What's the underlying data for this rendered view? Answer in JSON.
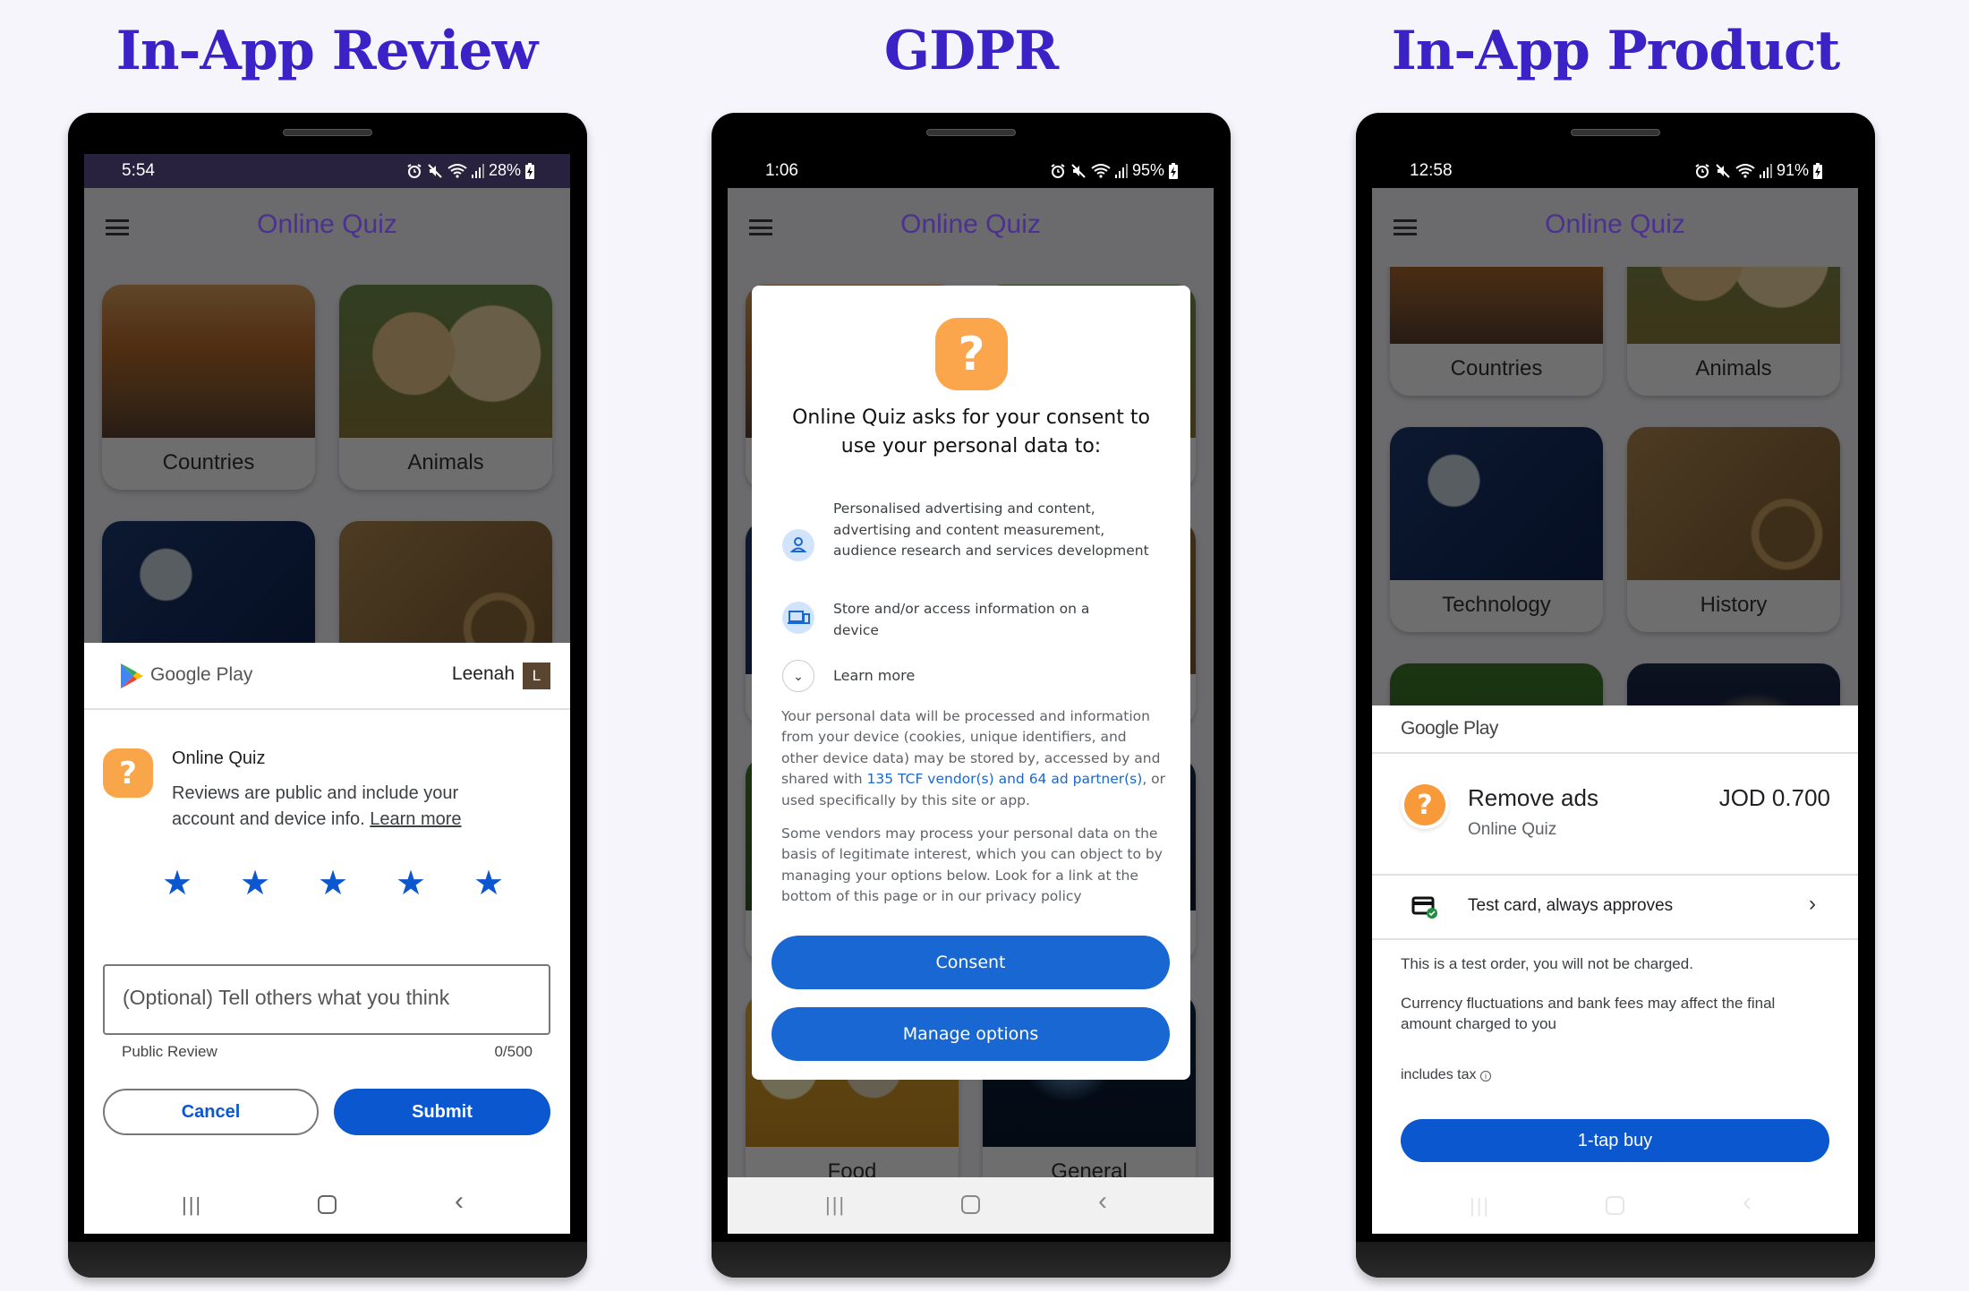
{
  "page_titles": [
    "In-App Review",
    "GDPR",
    "In-App Product"
  ],
  "app": {
    "title": "Online Quiz",
    "categories": [
      "Countries",
      "Animals",
      "Technology",
      "History",
      "",
      "",
      "Food",
      "General"
    ]
  },
  "review": {
    "status": {
      "time": "5:54",
      "battery": "28%"
    },
    "store_label": "Google Play",
    "user_name": "Leenah",
    "avatar_letter": "L",
    "app_name": "Online Quiz",
    "disclaimer": "Reviews are public and include your account and device info.",
    "learn_more": "Learn more",
    "rating": 5,
    "rating_max": 5,
    "review_placeholder": "(Optional) Tell others what you think",
    "review_helper": "Public Review",
    "char_count": "0/500",
    "cancel_label": "Cancel",
    "submit_label": "Submit"
  },
  "gdpr": {
    "status": {
      "time": "1:06",
      "battery": "95%"
    },
    "heading": "Online Quiz asks for your consent to use your personal data to:",
    "purposes": [
      {
        "icon": "person-icon",
        "text": "Personalised advertising and content, advertising and content measurement, audience research and services development"
      },
      {
        "icon": "devices-icon",
        "text": "Store and/or access information on a device"
      }
    ],
    "learn_more": "Learn more",
    "para1_a": "Your personal data will be processed and information from your device (cookies, unique identifiers, and other device data) may be stored by, accessed by and shared with ",
    "para1_link": "135 TCF vendor(s) and 64 ad partner(s)",
    "para1_b": ", or used specifically by this site or app.",
    "para2": "Some vendors may process your personal data on the basis of legitimate interest, which you can object to by managing your options below. Look for a link at the bottom of this page or in our privacy policy",
    "consent_label": "Consent",
    "manage_label": "Manage options",
    "accent": "#1967d2"
  },
  "product": {
    "status": {
      "time": "12:58",
      "battery": "91%"
    },
    "store_label": "Google Play",
    "product_name": "Remove ads",
    "app_name": "Online Quiz",
    "price": "JOD 0.700",
    "payment_method": "Test card, always approves",
    "test_notice": "This is a test order, you will not be charged.",
    "currency_notice": "Currency fluctuations and bank fees may affect the final amount charged to you",
    "tax_label": "includes tax",
    "buy_label": "1-tap buy",
    "accent": "#0b57d0"
  }
}
